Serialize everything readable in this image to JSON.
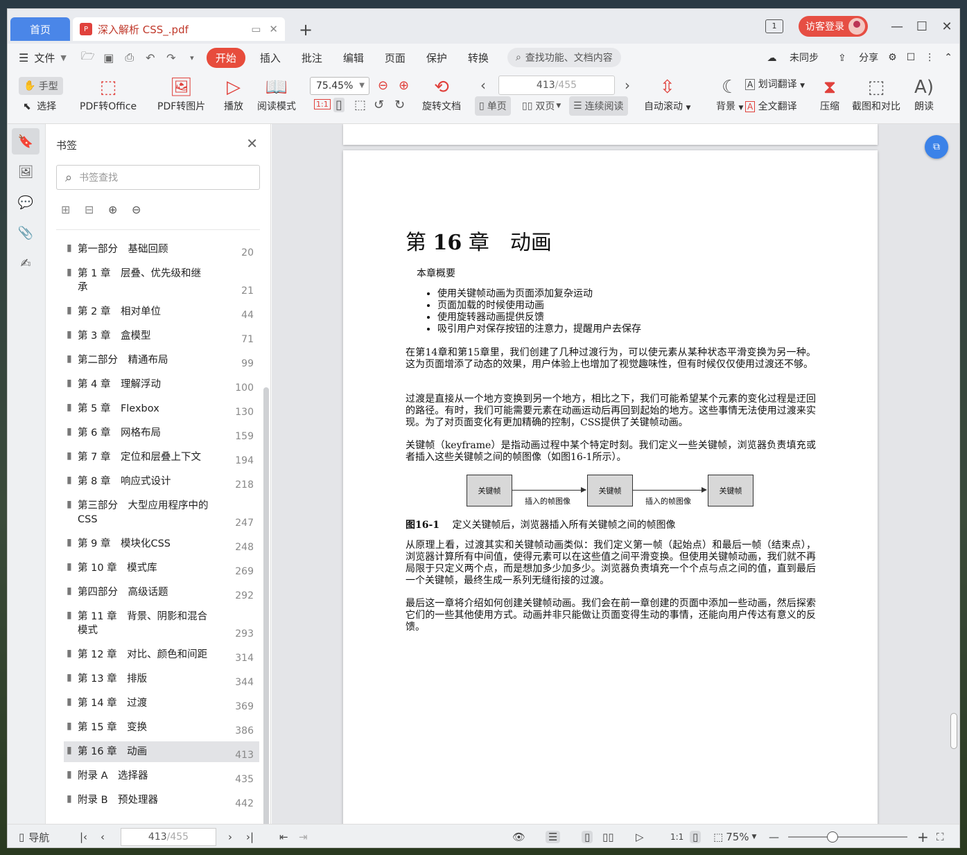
{
  "tabs": {
    "home": "首页",
    "doc_title": "深入解析 CSS_.pdf",
    "pdf_badge": "P"
  },
  "titlebar": {
    "window_count": "1",
    "login": "访客登录"
  },
  "menubar": {
    "file": "文件",
    "items": [
      "开始",
      "插入",
      "批注",
      "编辑",
      "页面",
      "保护",
      "转换"
    ],
    "search": "查找功能、文档内容",
    "sync": "未同步",
    "share": "分享"
  },
  "toolbar": {
    "hand": "手型",
    "select": "选择",
    "pdf_to_office": "PDF转Office",
    "pdf_to_image": "PDF转图片",
    "play": "播放",
    "read_mode": "阅读模式",
    "zoom": "75.45%",
    "rotate_doc": "旋转文档",
    "page_current": "413",
    "page_total": "/455",
    "single_page": "单页",
    "double_page": "双页",
    "continuous": "连续阅读",
    "auto_scroll": "自动滚动",
    "background": "背景",
    "word_translate": "划词翻译",
    "full_translate": "全文翻译",
    "compress": "压缩",
    "screenshot_compare": "截图和对比",
    "read_aloud": "朗读",
    "actual_size": "1:1"
  },
  "bookmarks": {
    "title": "书签",
    "search_placeholder": "书签查找",
    "items": [
      {
        "label": "第一部分　基础回顾",
        "page": "20"
      },
      {
        "label": "第 1 章　层叠、优先级和继承",
        "page": "21"
      },
      {
        "label": "第 2 章　相对单位",
        "page": "44"
      },
      {
        "label": "第 3 章　盒模型",
        "page": "71"
      },
      {
        "label": "第二部分　精通布局",
        "page": "99"
      },
      {
        "label": "第 4 章　理解浮动",
        "page": "100"
      },
      {
        "label": "第 5 章　Flexbox",
        "page": "130"
      },
      {
        "label": "第 6 章　网格布局",
        "page": "159"
      },
      {
        "label": "第 7 章　定位和层叠上下文",
        "page": "194"
      },
      {
        "label": "第 8 章　响应式设计",
        "page": "218"
      },
      {
        "label": "第三部分　大型应用程序中的CSS",
        "page": "247"
      },
      {
        "label": "第 9 章　模块化CSS",
        "page": "248"
      },
      {
        "label": "第 10 章　模式库",
        "page": "269"
      },
      {
        "label": "第四部分　高级话题",
        "page": "292"
      },
      {
        "label": "第 11 章　背景、阴影和混合模式",
        "page": "293"
      },
      {
        "label": "第 12 章　对比、颜色和间距",
        "page": "314"
      },
      {
        "label": "第 13 章　排版",
        "page": "344"
      },
      {
        "label": "第 14 章　过渡",
        "page": "369"
      },
      {
        "label": "第 15 章　变换",
        "page": "386"
      },
      {
        "label": "第 16 章　动画",
        "page": "413"
      },
      {
        "label": "附录 A　选择器",
        "page": "435"
      },
      {
        "label": "附录 B　预处理器",
        "page": "442"
      }
    ],
    "selected_index": 19
  },
  "document": {
    "chapter_prefix": "第",
    "chapter_num": "16",
    "chapter_suffix": "章　动画",
    "summary_heading": "本章概要",
    "summary": [
      "使用关键帧动画为页面添加复杂运动",
      "页面加载的时候使用动画",
      "使用旋转器动画提供反馈",
      "吸引用户对保存按钮的注意力，提醒用户去保存"
    ],
    "p1": "在第14章和第15章里，我们创建了几种过渡行为，可以使元素从某种状态平滑变换为另一种。这为页面增添了动态的效果，用户体验上也增加了视觉趣味性，但有时候仅仅使用过渡还不够。",
    "p2": "过渡是直接从一个地方变换到另一个地方，相比之下，我们可能希望某个元素的变化过程是迂回的路径。有时，我们可能需要元素在动画运动后再回到起始的地方。这些事情无法使用过渡来实现。为了对页面变化有更加精确的控制，CSS提供了关键帧动画。",
    "p3": "关键帧（keyframe）是指动画过程中某个特定时刻。我们定义一些关键帧，浏览器负责填充或者插入这些关键帧之间的帧图像（如图16-1所示）。",
    "figure": {
      "box": "关键帧",
      "arrow_label": "插入的帧图像",
      "caption_num": "图16-1",
      "caption": "定义关键帧后，浏览器插入所有关键帧之间的帧图像"
    },
    "p4": "从原理上看，过渡其实和关键帧动画类似：我们定义第一帧（起始点）和最后一帧（结束点），浏览器计算所有中间值，使得元素可以在这些值之间平滑变换。但使用关键帧动画，我们就不再局限于只定义两个点，而是想加多少加多少。浏览器负责填充一个个点与点之间的值，直到最后一个关键帧，最终生成一系列无缝衔接的过渡。",
    "p5": "最后这一章将介绍如何创建关键帧动画。我们会在前一章创建的页面中添加一些动画，然后探索它们的一些其他使用方式。动画并非只能做让页面变得生动的事情，还能向用户传达有意义的反馈。"
  },
  "statusbar": {
    "nav": "导航",
    "page_current": "413",
    "page_total": "/455",
    "actual_size": "1:1",
    "zoom": "75%"
  },
  "colors": {
    "accent_red": "#e74c3c",
    "home_tab": "#4a86e8",
    "float_button": "#3b82e8"
  }
}
